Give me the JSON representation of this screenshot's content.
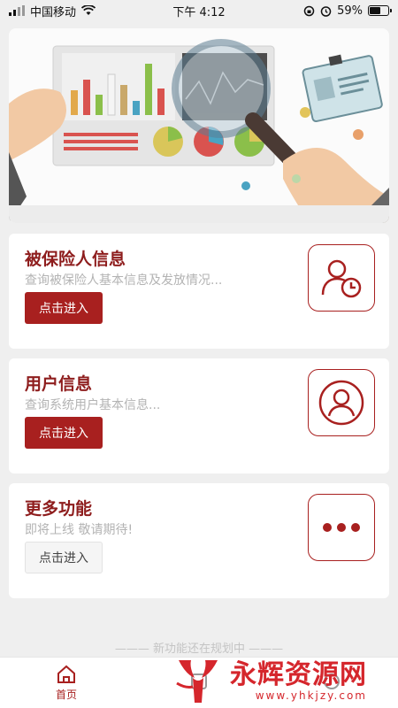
{
  "status_bar": {
    "carrier": "中国移动",
    "time": "下午 4:12",
    "battery": "59%",
    "battery_level": 0.59
  },
  "cards": [
    {
      "title": "被保险人信息",
      "description": "查询被保险人基本信息及发放情况...",
      "button": "点击进入",
      "icon": "user-clock-icon"
    },
    {
      "title": "用户信息",
      "description": "查询系统用户基本信息...",
      "button": "点击进入",
      "icon": "user-circle-icon"
    },
    {
      "title": "更多功能",
      "description": "即将上线 敬请期待!",
      "button": "点击进入",
      "icon": "more-dots-icon"
    }
  ],
  "footer_note": "——— 新功能还在规划中 ———",
  "tabbar": {
    "items": [
      {
        "label": "首页",
        "icon": "home-icon"
      },
      {
        "label": "",
        "icon": ""
      },
      {
        "label": "",
        "icon": ""
      }
    ]
  },
  "watermark": {
    "title": "永辉资源网",
    "url": "www.yhkjzy.com"
  },
  "colors": {
    "accent": "#a8201f",
    "title": "#8e1d1d",
    "watermark": "#d5262c"
  }
}
